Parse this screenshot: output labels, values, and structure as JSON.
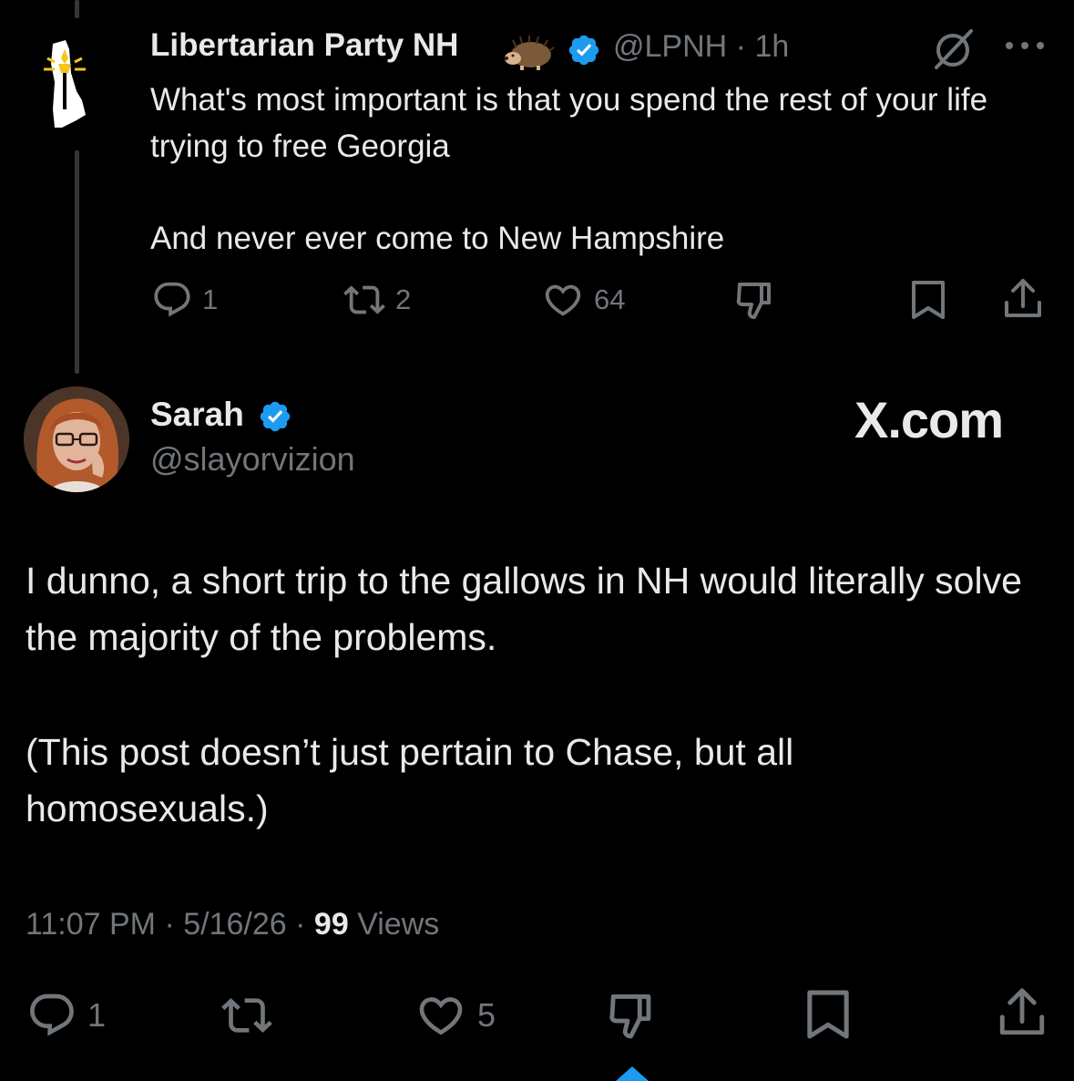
{
  "parent_tweet": {
    "author_name": "Libertarian Party NH",
    "handle": "@LPNH",
    "time": "1h",
    "text_line1": "What's most important is that you spend the rest of your life trying to free Georgia",
    "text_line2": "And never ever come to New Hampshire",
    "replies": "1",
    "reposts": "2",
    "likes": "64"
  },
  "main_tweet": {
    "author_name": "Sarah",
    "handle": "@slayorvizion",
    "watermark": "X.com",
    "text_para1": "I dunno, a short trip to the gallows in NH would literally solve the majority of the problems.",
    "text_para2": "(This post doesn’t just pertain to Chase, but all homosexuals.)",
    "time": "11:07 PM",
    "date": "5/16/26",
    "views_count": "99",
    "views_label": "Views",
    "replies": "1",
    "likes": "5"
  },
  "colors": {
    "background": "#000000",
    "text": "#e7e9ea",
    "muted": "#71767b",
    "verified": "#1d9bf0"
  },
  "icons": [
    "hedgehog-icon",
    "verified-badge-icon",
    "grok-icon",
    "more-icon",
    "reply-icon",
    "repost-icon",
    "like-icon",
    "dislike-icon",
    "bookmark-icon",
    "share-icon"
  ]
}
